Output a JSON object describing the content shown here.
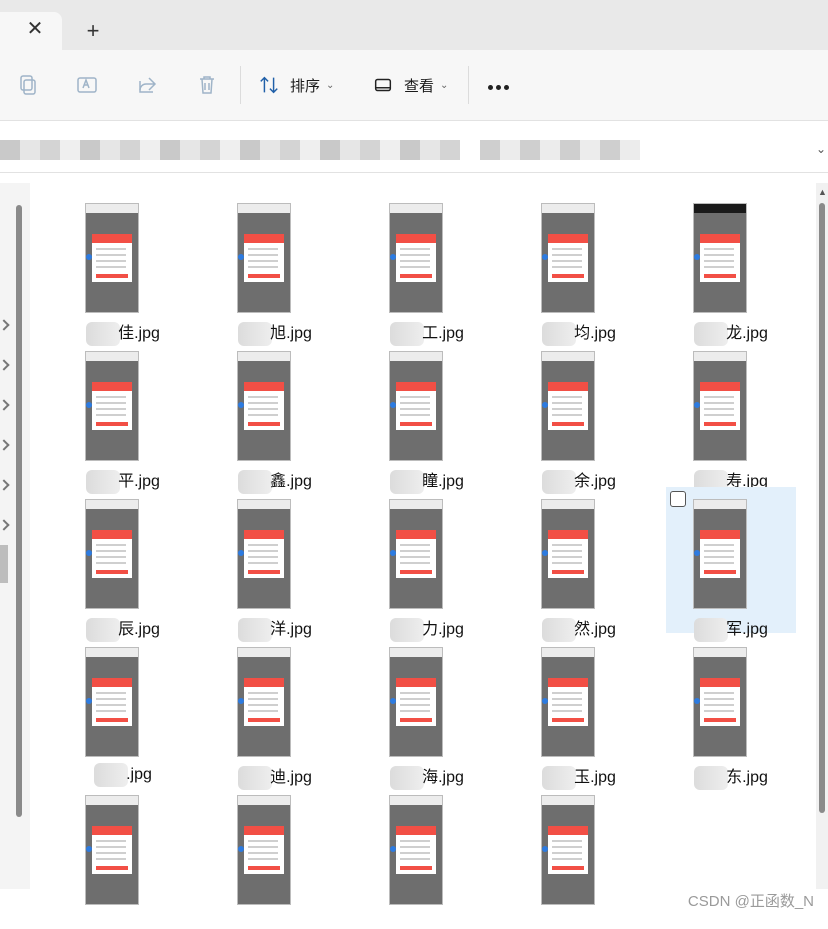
{
  "tabbar": {
    "close_glyph": "✕",
    "new_tab_glyph": "+"
  },
  "toolbar": {
    "copy_icon": "copy-icon",
    "rename_icon": "rename-icon",
    "share_icon": "share-icon",
    "delete_icon": "delete-icon",
    "sort_label": "排序",
    "view_label": "查看",
    "more_label": "···"
  },
  "address": {
    "chevron": "⌄"
  },
  "files": [
    {
      "name": "佳.jpg",
      "dark": false,
      "selected": false
    },
    {
      "name": "旭.jpg",
      "dark": false,
      "selected": false
    },
    {
      "name": "工.jpg",
      "dark": false,
      "selected": false
    },
    {
      "name": "均.jpg",
      "dark": false,
      "selected": false
    },
    {
      "name": "龙.jpg",
      "dark": true,
      "selected": false
    },
    {
      "name": "平.jpg",
      "dark": false,
      "selected": false
    },
    {
      "name": "鑫.jpg",
      "dark": false,
      "selected": false
    },
    {
      "name": "瞳.jpg",
      "dark": false,
      "selected": false
    },
    {
      "name": "余.jpg",
      "dark": false,
      "selected": false
    },
    {
      "name": "寿.jpg",
      "dark": false,
      "selected": false
    },
    {
      "name": "辰.jpg",
      "dark": false,
      "selected": false
    },
    {
      "name": "洋.jpg",
      "dark": false,
      "selected": false
    },
    {
      "name": "力.jpg",
      "dark": false,
      "selected": false
    },
    {
      "name": "然.jpg",
      "dark": false,
      "selected": false
    },
    {
      "name": "军.jpg",
      "dark": false,
      "selected": true
    },
    {
      "name": ".jpg",
      "dark": false,
      "selected": false
    },
    {
      "name": "迪.jpg",
      "dark": false,
      "selected": false
    },
    {
      "name": "海.jpg",
      "dark": false,
      "selected": false
    },
    {
      "name": "玉.jpg",
      "dark": false,
      "selected": false
    },
    {
      "name": "东.jpg",
      "dark": false,
      "selected": false
    },
    {
      "name": "",
      "dark": false,
      "selected": false
    },
    {
      "name": "",
      "dark": false,
      "selected": false
    },
    {
      "name": "",
      "dark": false,
      "selected": false
    },
    {
      "name": "",
      "dark": false,
      "selected": false
    }
  ],
  "watermark": "CSDN @正函数_N"
}
